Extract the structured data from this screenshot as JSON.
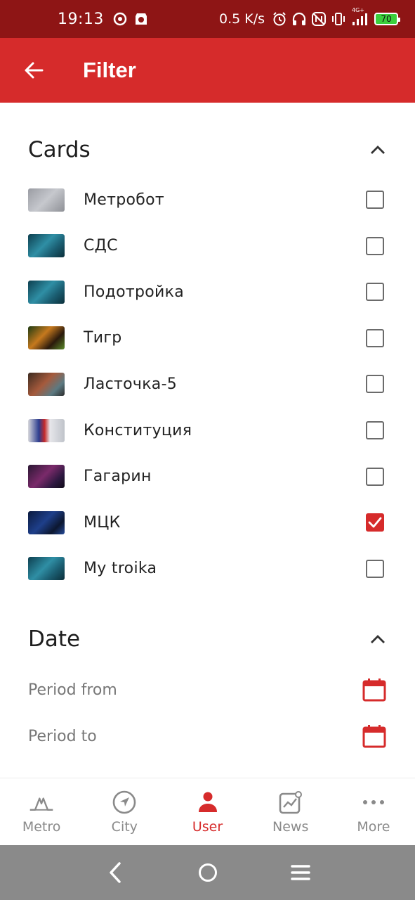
{
  "status_bar": {
    "time": "19:13",
    "net_speed": "0.5 K/s",
    "network": "4G+",
    "battery": "70",
    "icons": [
      "music-app-icon",
      "ticket-app-icon",
      "alarm-icon",
      "headphones-icon",
      "nfc-icon",
      "vibrate-icon",
      "signal-icon",
      "battery-icon"
    ]
  },
  "app_bar": {
    "title": "Filter",
    "back_icon": "arrow-left-icon"
  },
  "cards_section": {
    "title": "Cards",
    "collapse_icon": "chevron-up-icon",
    "items": [
      {
        "name": "Метробот",
        "checked": false,
        "thumb": "metrobot"
      },
      {
        "name": "СДС",
        "checked": false,
        "thumb": "troika"
      },
      {
        "name": "Подотройка",
        "checked": false,
        "thumb": "troika"
      },
      {
        "name": "Тигр",
        "checked": false,
        "thumb": "tiger"
      },
      {
        "name": "Ласточка-5",
        "checked": false,
        "thumb": "lastochka"
      },
      {
        "name": "Конституция",
        "checked": false,
        "thumb": "constitution"
      },
      {
        "name": "Гагарин",
        "checked": false,
        "thumb": "gagarin"
      },
      {
        "name": "МЦК",
        "checked": true,
        "thumb": "mck"
      },
      {
        "name": "My troika",
        "checked": false,
        "thumb": "troika"
      }
    ]
  },
  "date_section": {
    "title": "Date",
    "collapse_icon": "chevron-up-icon",
    "period_from": "Period from",
    "period_to": "Period to",
    "calendar_icon": "calendar-icon"
  },
  "bottom_nav": {
    "items": [
      {
        "label": "Metro",
        "icon": "metro-logo-icon",
        "active": false
      },
      {
        "label": "City",
        "icon": "navigation-icon",
        "active": false
      },
      {
        "label": "User",
        "icon": "user-icon",
        "active": true
      },
      {
        "label": "News",
        "icon": "news-chart-icon",
        "active": false
      },
      {
        "label": "More",
        "icon": "more-dots-icon",
        "active": false
      }
    ]
  },
  "colors": {
    "accent": "#d62b2b",
    "status_bar": "#8e1515",
    "system_nav": "#8a8a8a",
    "inactive": "#8a8a8a"
  },
  "system_nav": {
    "icons": [
      "back-icon",
      "home-icon",
      "menu-icon"
    ]
  }
}
